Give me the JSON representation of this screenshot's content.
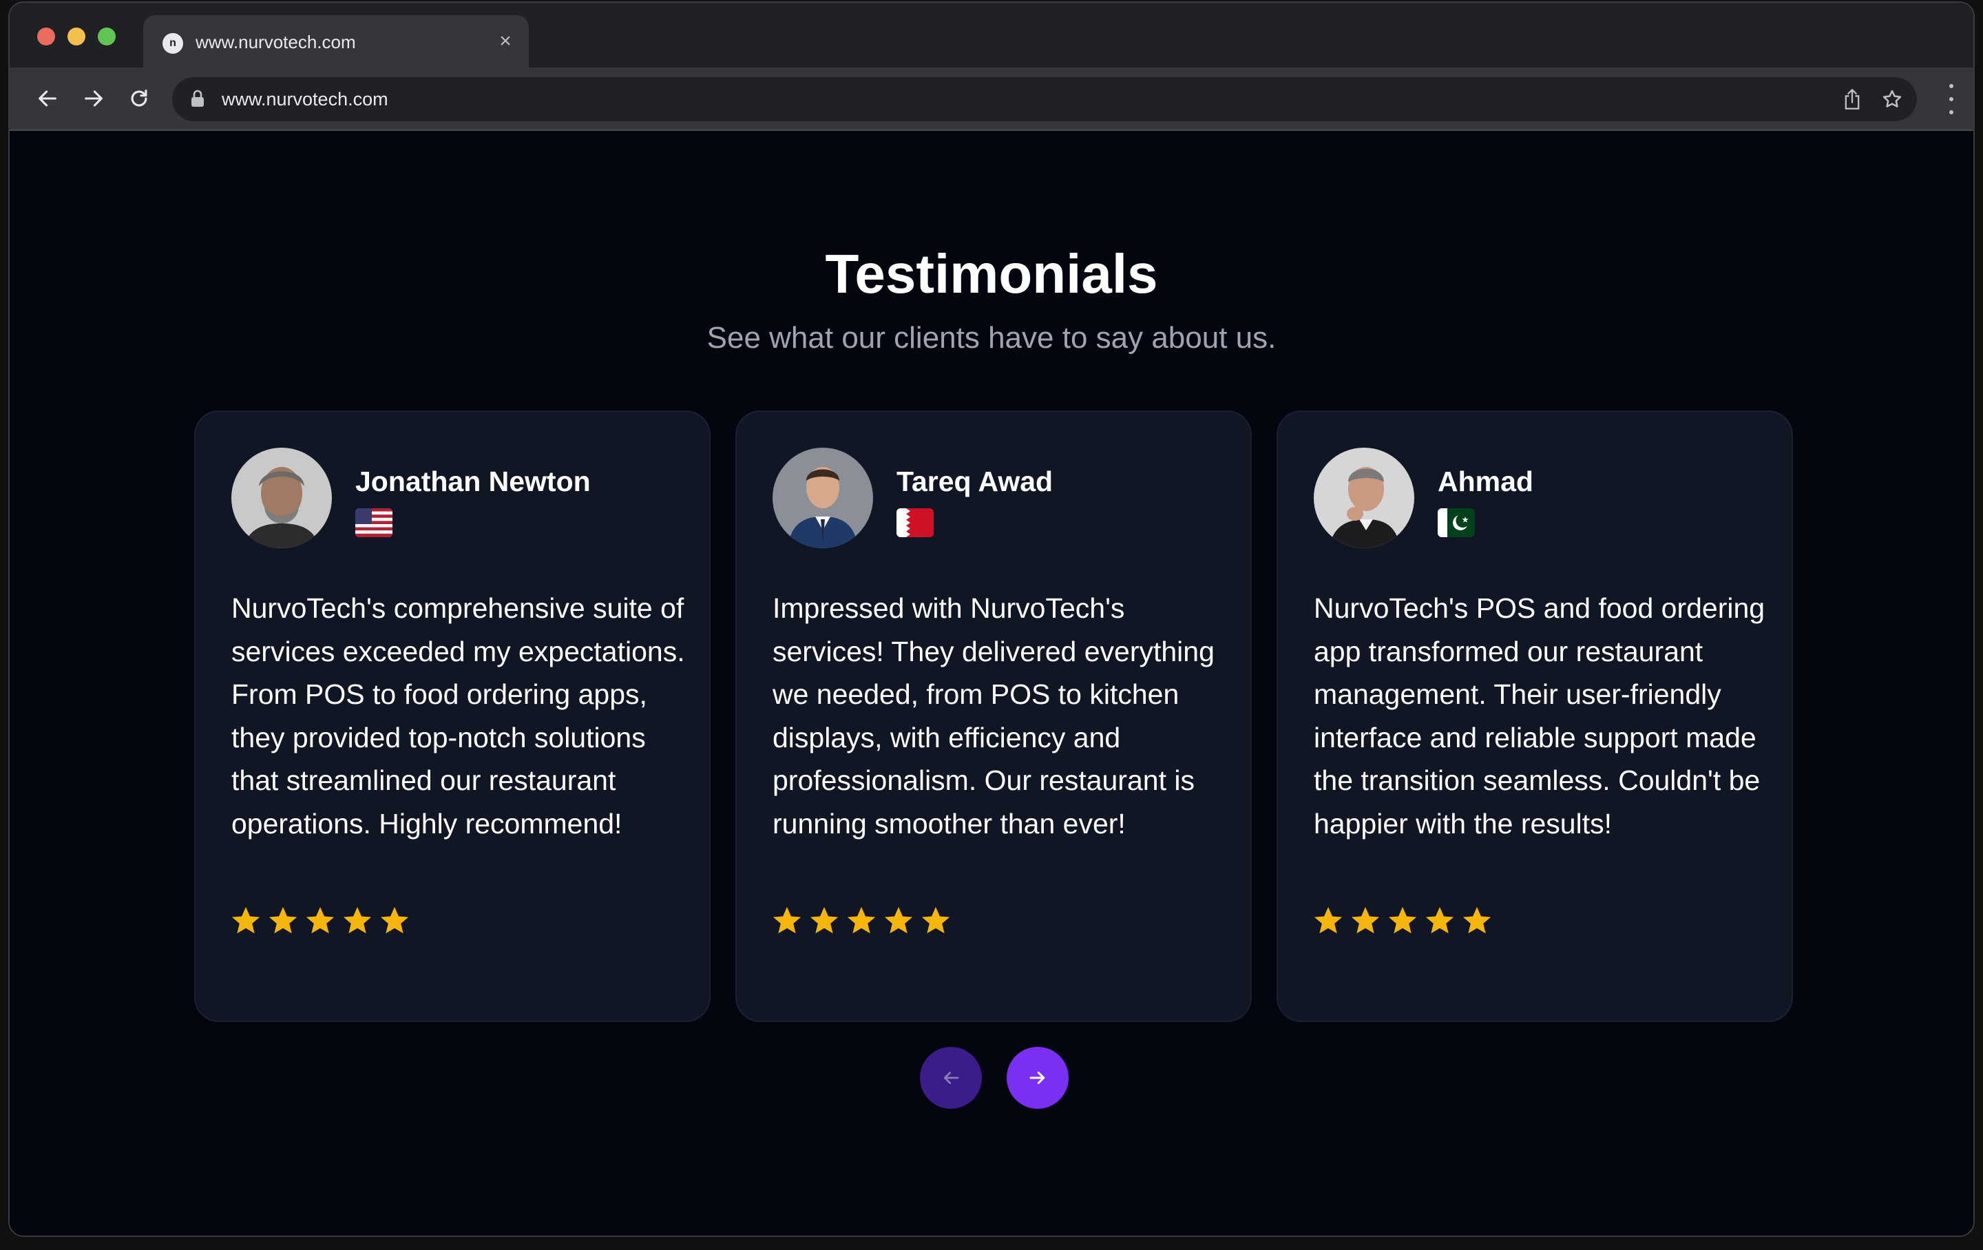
{
  "browser": {
    "tab_title": "www.nurvotech.com",
    "url": "www.nurvotech.com",
    "tab_close": "×"
  },
  "section": {
    "title": "Testimonials",
    "subtitle": "See what our clients have to say about us."
  },
  "testimonials": [
    {
      "name": "Jonathan Newton",
      "country_flag": "us-flag",
      "quote": "NurvoTech's comprehensive suite of services exceeded my expectations. From POS to food ordering apps, they provided top-notch solutions that streamlined our restaurant operations. Highly recommend!",
      "rating": 5
    },
    {
      "name": "Tareq Awad",
      "country_flag": "bahrain-flag",
      "quote": "Impressed with NurvoTech's services! They delivered everything we needed, from POS to kitchen displays, with efficiency and professionalism. Our restaurant is running smoother than ever!",
      "rating": 5
    },
    {
      "name": "Ahmad",
      "country_flag": "pakistan-flag",
      "quote": "NurvoTech's POS and food ordering app transformed our restaurant management. Their user-friendly interface and reliable support made the transition seamless. Couldn't be happier with the results!",
      "rating": 5
    }
  ],
  "colors": {
    "page_background": "#03050f",
    "card_background": "#111625",
    "star": "#f5b50a",
    "accent": "#7b2ff2",
    "accent_dim": "#3b1d8a"
  }
}
